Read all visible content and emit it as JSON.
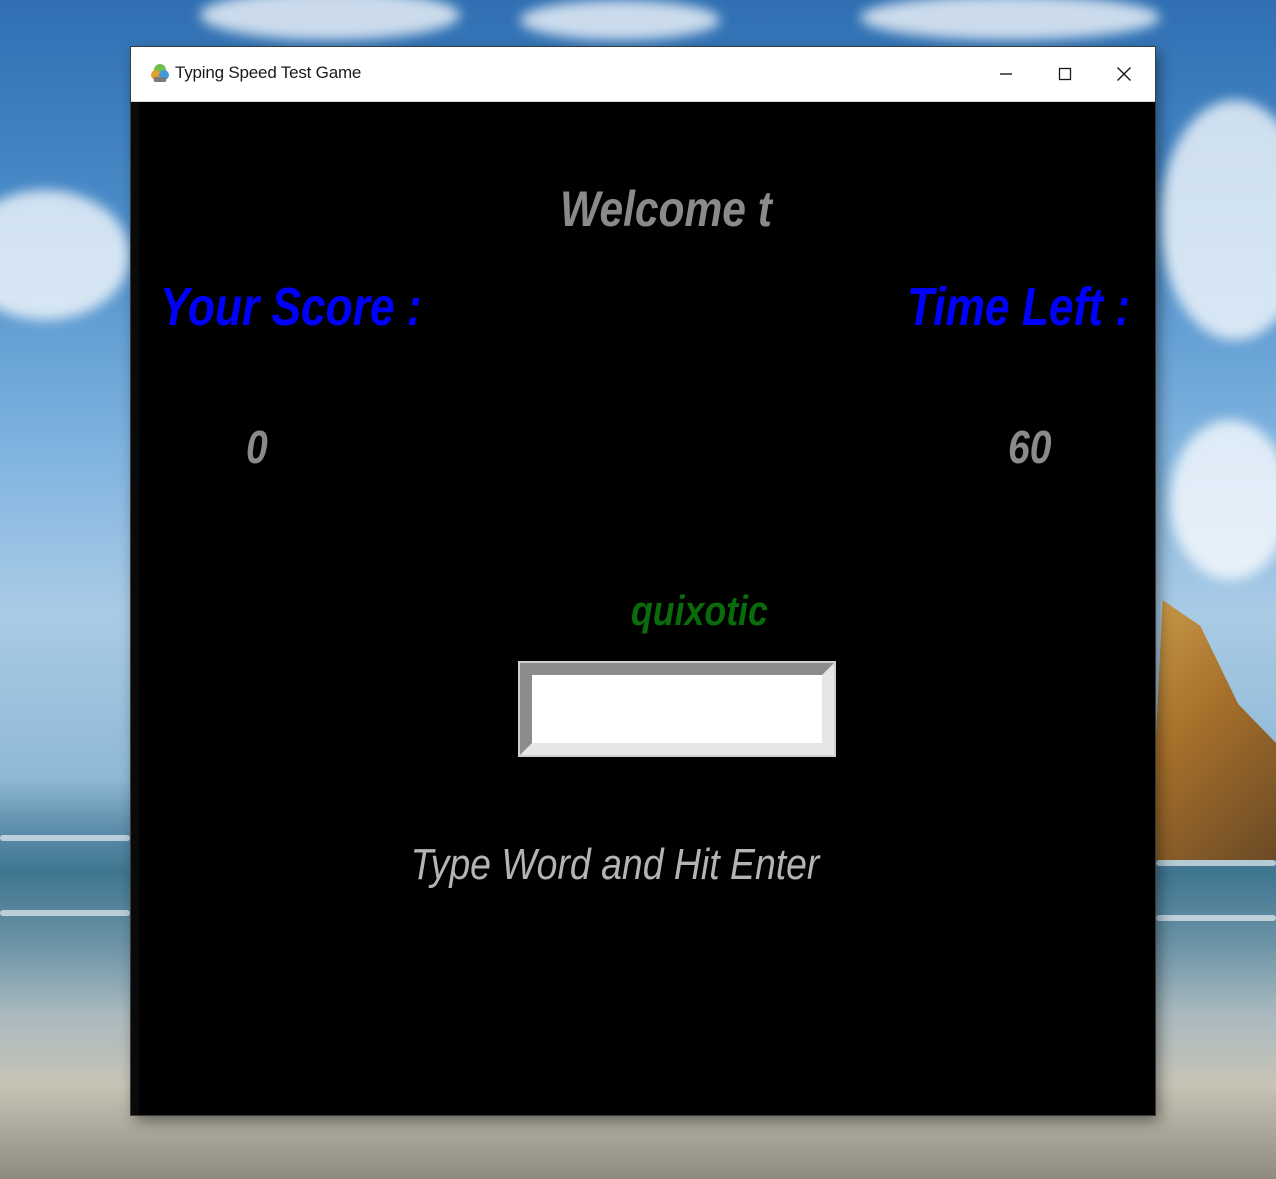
{
  "window": {
    "title": "Typing Speed Test Game",
    "icon": "app-icon",
    "controls": {
      "minimize_icon": "minimize-icon",
      "maximize_icon": "maximize-icon",
      "close_icon": "close-icon"
    }
  },
  "game": {
    "welcome": "Welcome t",
    "score_label": "Your Score :",
    "score_value": "0",
    "time_label": "Time Left :",
    "time_value": "60",
    "current_word": "quixotic",
    "entry_value": "",
    "hint": "Type Word and Hit Enter"
  },
  "colors": {
    "background": "#000000",
    "label_blue": "#0000ff",
    "value_grey": "#8a8a8a",
    "word_green": "#0a6b0a",
    "hint_grey": "#b4b4b4"
  }
}
